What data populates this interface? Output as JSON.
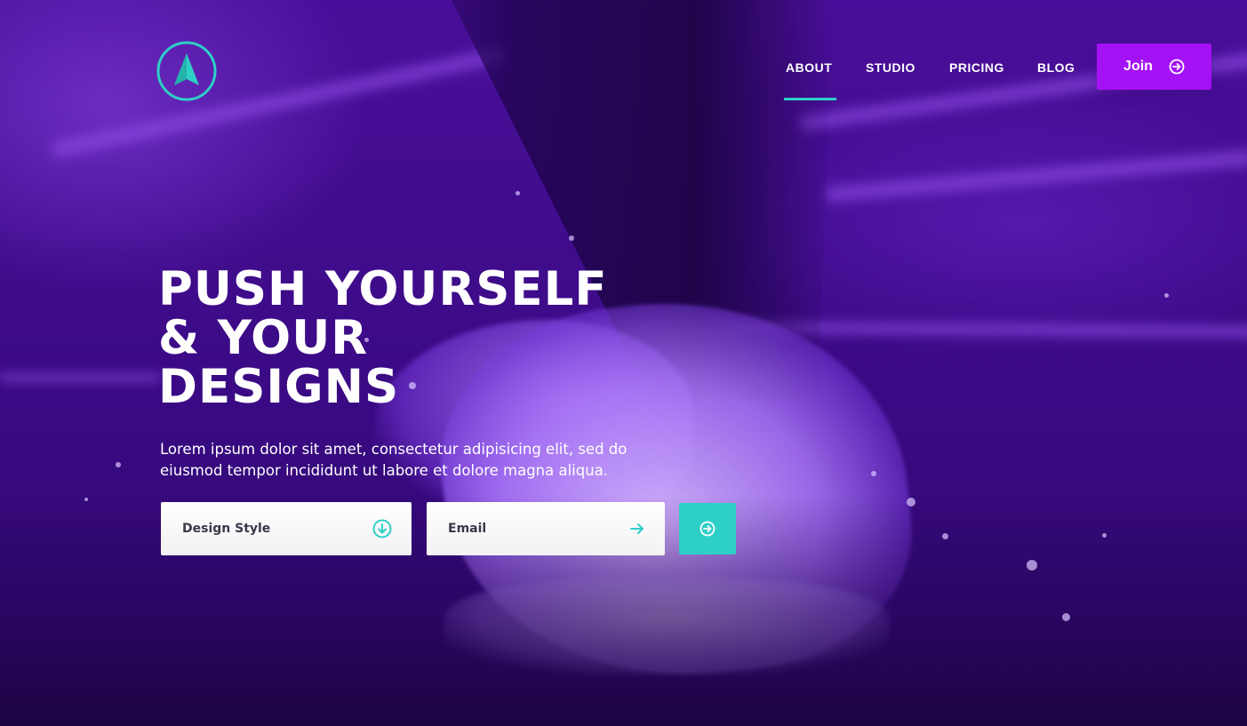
{
  "brand": {
    "accent": "#2ecfc7",
    "purple": "#a411f5",
    "background": "#3d0a86",
    "logo_icon": "arrow-logo-icon"
  },
  "nav": {
    "items": [
      {
        "label": "ABOUT",
        "active": true
      },
      {
        "label": "STUDIO",
        "active": false
      },
      {
        "label": "PRICING",
        "active": false
      },
      {
        "label": "BLOG",
        "active": false
      }
    ],
    "join_label": "Join",
    "join_icon": "arrow-circle-right-icon"
  },
  "hero": {
    "title_lines": [
      "PUSH YOURSELF",
      "& YOUR",
      "DESIGNS"
    ],
    "subtitle": "Lorem ipsum dolor sit amet, consectetur adipisicing elit, sed do eiusmod tempor incididunt ut labore et dolore magna aliqua."
  },
  "form": {
    "style_label": "Design Style",
    "style_icon": "download-circle-icon",
    "email_label": "Email",
    "email_icon": "arrow-right-icon",
    "submit_icon": "arrow-circle-right-icon"
  }
}
